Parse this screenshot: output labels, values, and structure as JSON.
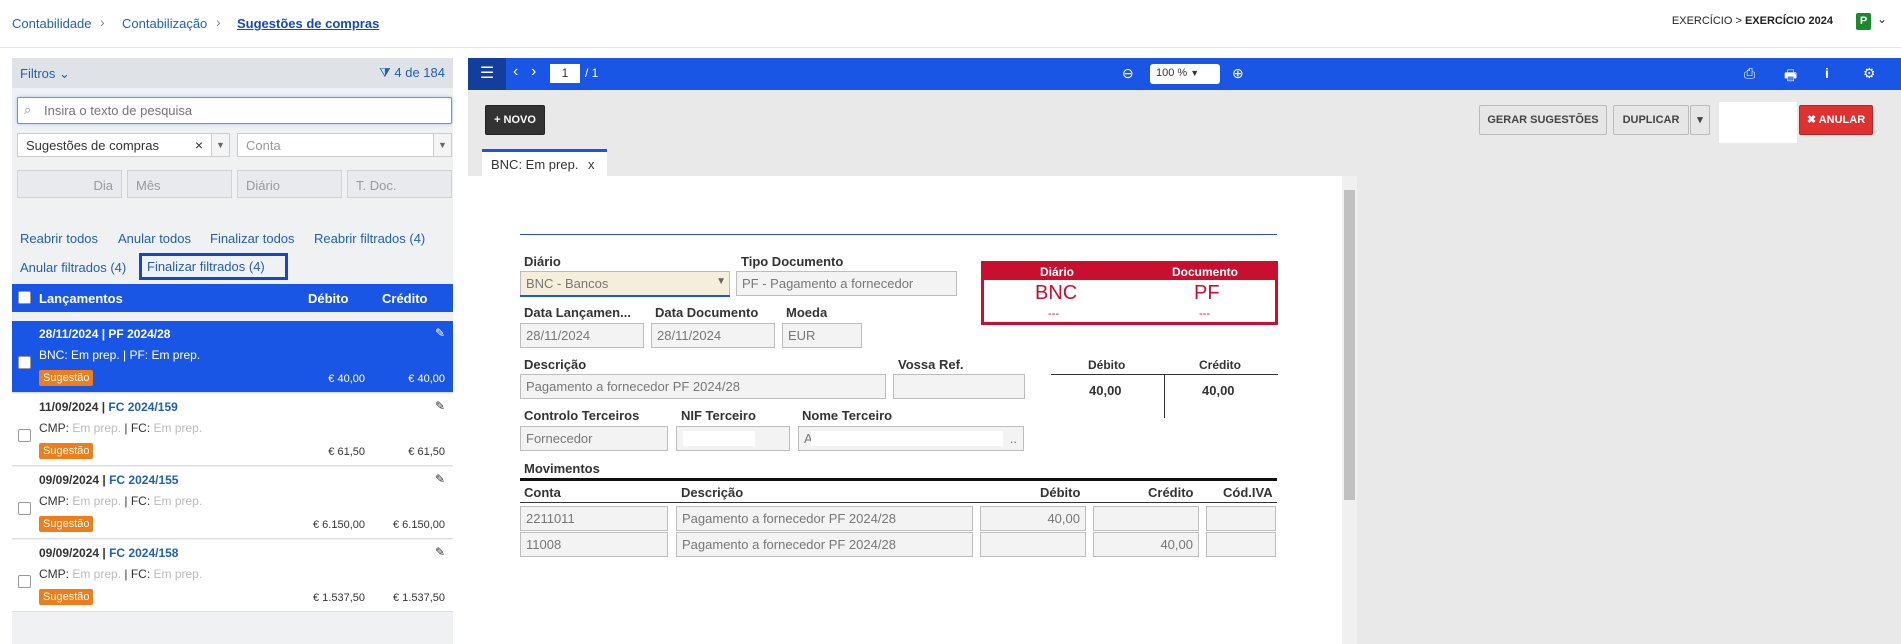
{
  "breadcrumb": [
    "Contabilidade",
    "Contabilização",
    "Sugestões de compras"
  ],
  "exercicio": {
    "label": "EXERCÍCIO > ",
    "value": "EXERCÍCIO 2024",
    "badge": "P"
  },
  "filters": {
    "title": "Filtros",
    "count": "4 de 184",
    "search_placeholder": "Insira o texto de pesquisa",
    "select1": "Sugestões de compras",
    "select2": "Conta",
    "dia": "Dia",
    "mes": "Mês",
    "diario": "Diário",
    "tdoc": "T. Doc."
  },
  "actions": {
    "reabrir_todos": "Reabrir todos",
    "anular_todos": "Anular todos",
    "finalizar_todos": "Finalizar todos",
    "reabrir_filtrados": "Reabrir filtrados (4)",
    "anular_filtrados": "Anular filtrados (4)",
    "finalizar_filtrados": "Finalizar filtrados (4)"
  },
  "list_header": {
    "lancamentos": "Lançamentos",
    "debito": "Débito",
    "credito": "Crédito"
  },
  "entries": [
    {
      "date": "28/11/2024 | ",
      "doc": "PF 2024/28",
      "status": "BNC: Em prep. | PF: Em prep.",
      "badge": "Sugestão",
      "debito": "€ 40,00",
      "credito": "€ 40,00"
    },
    {
      "date": "11/09/2024 | ",
      "doc": "FC 2024/159",
      "pre1": "CMP: ",
      "st1": "Em prep.",
      "pre2": " | FC: ",
      "st2": "Em prep.",
      "badge": "Sugestão",
      "debito": "€ 61,50",
      "credito": "€ 61,50"
    },
    {
      "date": "09/09/2024 | ",
      "doc": "FC 2024/155",
      "pre1": "CMP: ",
      "st1": "Em prep.",
      "pre2": " | FC: ",
      "st2": "Em prep.",
      "badge": "Sugestão",
      "debito": "€ 6.150,00",
      "credito": "€ 6.150,00"
    },
    {
      "date": "09/09/2024 | ",
      "doc": "FC 2024/158",
      "pre1": "CMP: ",
      "st1": "Em prep.",
      "pre2": " | FC: ",
      "st2": "Em prep.",
      "badge": "Sugestão",
      "debito": "€ 1.537,50",
      "credito": "€ 1.537,50"
    }
  ],
  "viewer": {
    "page": "1",
    "pages": "/ 1",
    "zoom": "100 %",
    "novo": "+ NOVO",
    "gerar": "GERAR SUGESTÕES",
    "duplicar": "DUPLICAR",
    "anular": "✖ ANULAR",
    "tab": "BNC: Em prep.",
    "tab_close": "x"
  },
  "doc": {
    "diario_label": "Diário",
    "diario_value": "BNC - Bancos",
    "tipo_label": "Tipo Documento",
    "tipo_value": "PF - Pagamento a fornecedor",
    "box": {
      "h1": "Diário",
      "h2": "Documento",
      "v1": "BNC",
      "v2": "PF",
      "d1": "---",
      "d2": "---"
    },
    "data_lanc_label": "Data Lançamen...",
    "data_lanc": "28/11/2024",
    "data_doc_label": "Data Documento",
    "data_doc": "28/11/2024",
    "moeda_label": "Moeda",
    "moeda": "EUR",
    "descricao_label": "Descrição",
    "descricao": "Pagamento a fornecedor PF 2024/28",
    "vossa_label": "Vossa Ref.",
    "vossa": "",
    "tot_debito_label": "Débito",
    "tot_credito_label": "Crédito",
    "tot_debito": "40,00",
    "tot_credito": "40,00",
    "controlo_label": "Controlo Terceiros",
    "controlo": "Fornecedor",
    "nif_label": "NIF Terceiro",
    "nome_label": "Nome Terceiro",
    "nome_prefix": "A",
    "nome_suffix": "..",
    "mov_label": "Movimentos",
    "mov_cols": [
      "Conta",
      "Descrição",
      "Débito",
      "Crédito",
      "Cód.IVA"
    ],
    "mov_rows": [
      {
        "conta": "2211011",
        "desc": "Pagamento a fornecedor PF 2024/28",
        "deb": "40,00",
        "cred": ""
      },
      {
        "conta": "11008",
        "desc": "Pagamento a fornecedor PF 2024/28",
        "deb": "",
        "cred": "40,00"
      }
    ]
  }
}
